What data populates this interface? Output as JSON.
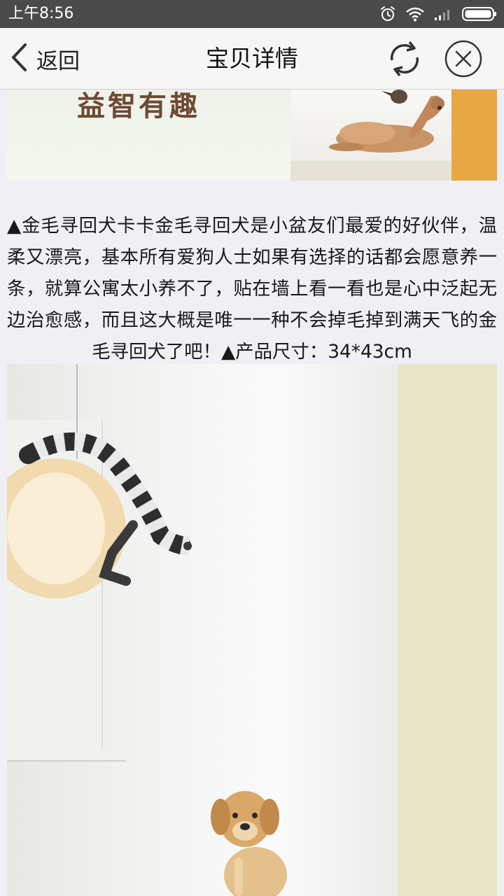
{
  "status_bar": {
    "time": "上午8:56",
    "icons": [
      "alarm-icon",
      "wifi-icon",
      "signal-icon",
      "battery-icon"
    ]
  },
  "nav": {
    "back_label": "返回",
    "title": "宝贝详情",
    "refresh_icon": "refresh-icon",
    "close_icon": "close-icon"
  },
  "top_image": {
    "caption": "益智有趣",
    "colors": {
      "caption": "#6f4a33",
      "wall": "#e7a743"
    }
  },
  "description": "▲金毛寻回犬卡卡金毛寻回犬是小盆友们最爱的好伙伴，温柔又漂亮，基本所有爱狗人士如果有选择的话都会愿意养一条，就算公寓太小养不了，贴在墙上看一看也是心中泛起无边治愈感，而且这大概是唯一一种不会掉毛掉到满天飞的金毛寻回犬了吧！▲产品尺寸：34*43cm",
  "colors": {
    "status_bar_bg": "#4a4a4a",
    "nav_bg": "#f6f6f6",
    "page_bg": "#efeff4"
  }
}
